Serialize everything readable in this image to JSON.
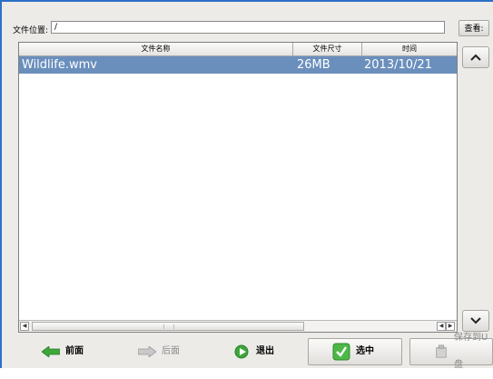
{
  "path_bar": {
    "label": "文件位置:",
    "value": "/",
    "view_button": "查看:"
  },
  "table": {
    "columns": [
      "文件名称",
      "文件尺寸",
      "时间"
    ],
    "rows": [
      {
        "name": "Wildlife.wmv",
        "size": "26MB",
        "date": "2013/10/21",
        "selected": true
      }
    ]
  },
  "bottom_bar": {
    "prev": "前面",
    "next": "后面",
    "exit": "退出",
    "select": "选中",
    "save_usb": "保存到U盘"
  },
  "icons": {
    "prev": "arrow-left-icon",
    "next": "arrow-right-icon",
    "exit": "exit-icon",
    "select": "checkmark-icon",
    "save": "usb-save-icon",
    "scroll_up": "chevron-up-icon",
    "scroll_down": "chevron-down-icon"
  },
  "colors": {
    "selection": "#6a8fbd",
    "accent_green": "#3ea63a",
    "frame_blue": "#2d6fc7"
  }
}
